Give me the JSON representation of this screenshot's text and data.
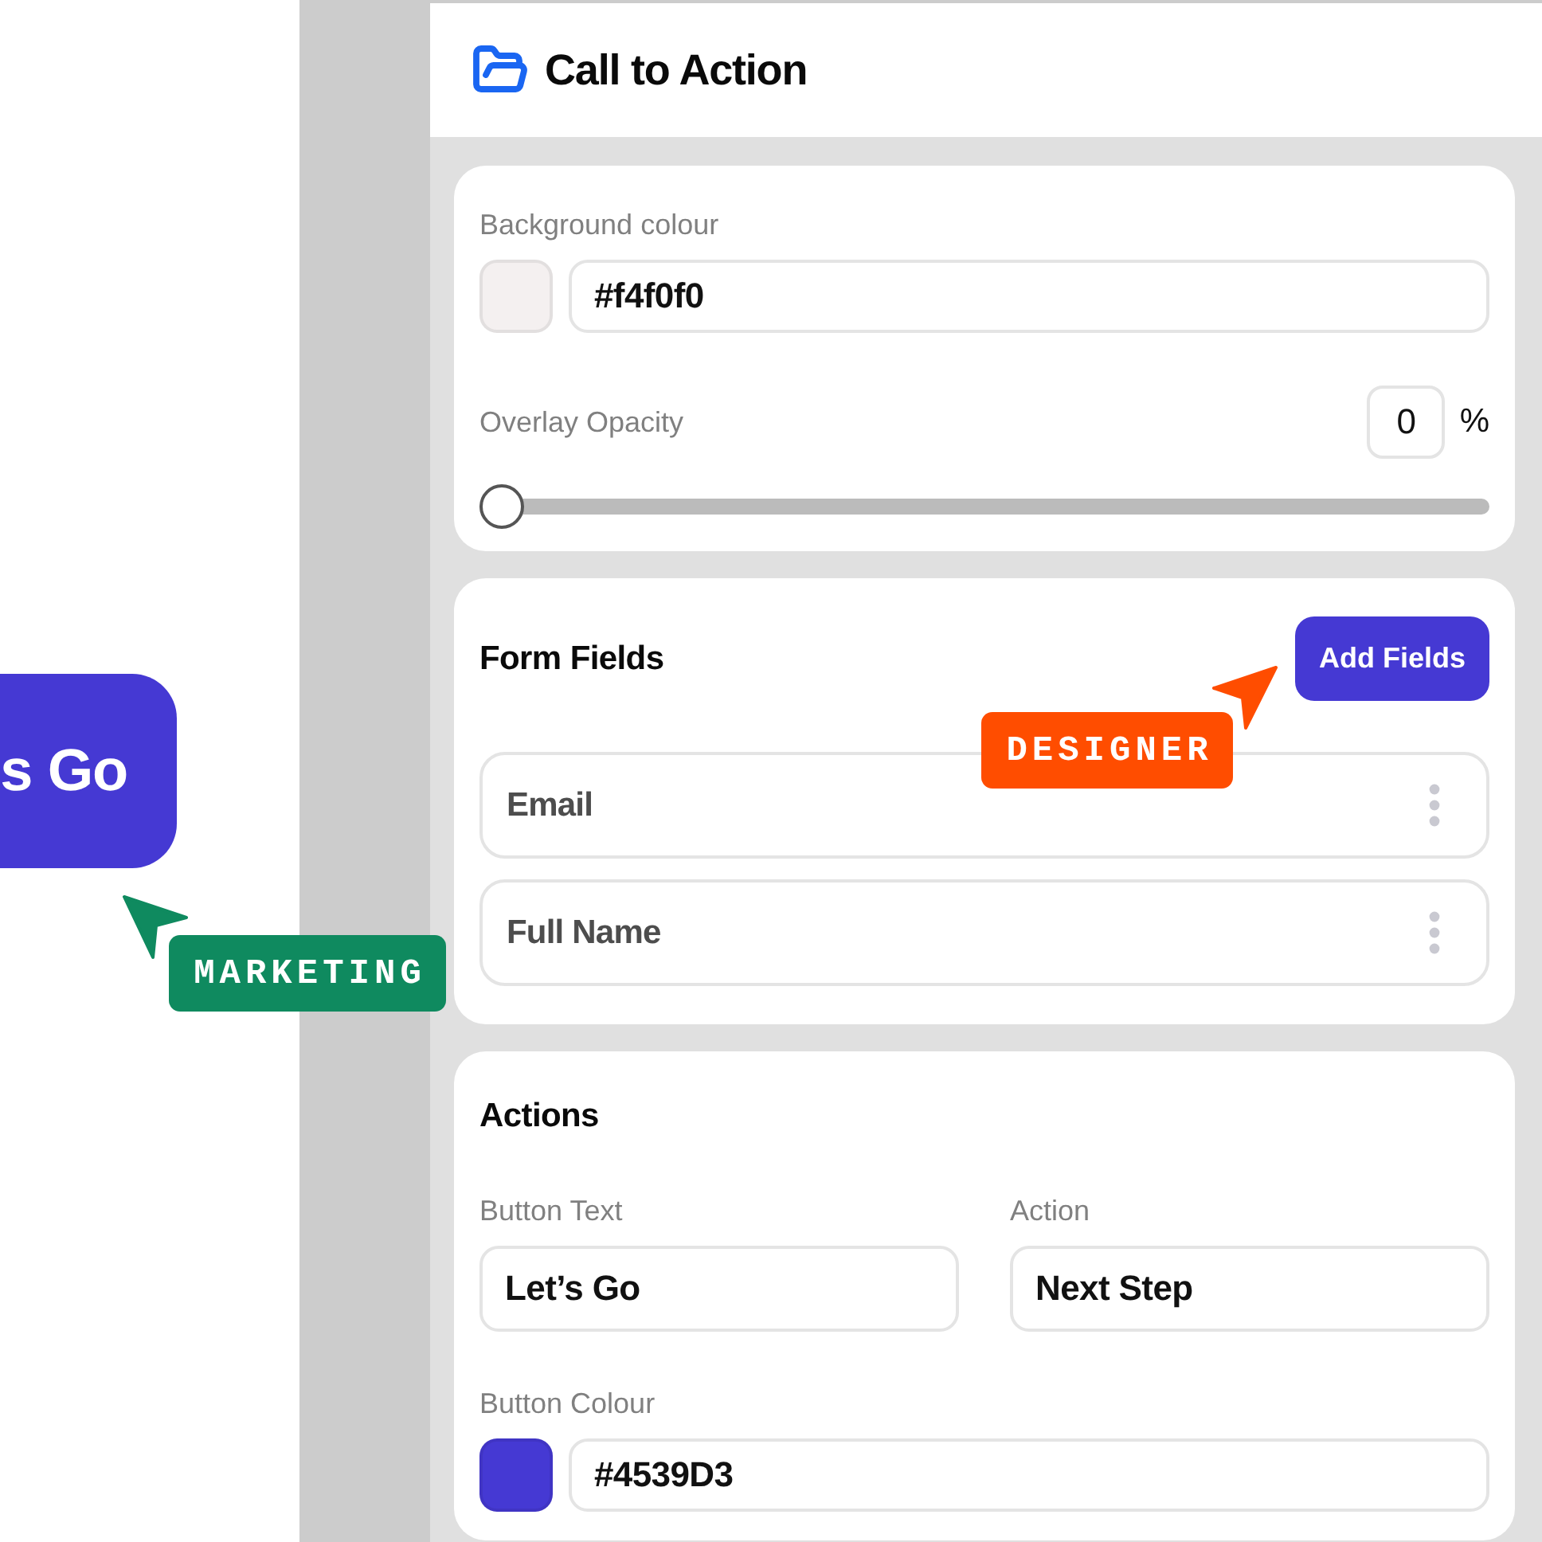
{
  "canvas": {
    "preview_button": {
      "label": "s Go"
    }
  },
  "cursors": [
    {
      "label": "MARKETING",
      "color": "#0f8a5f"
    },
    {
      "label": "DESIGNER",
      "color": "#ff4d00"
    }
  ],
  "panel": {
    "title": "Call to Action"
  },
  "appearance": {
    "background_colour": {
      "label": "Background colour",
      "value": "#f4f0f0",
      "color": "#f4f0f0"
    },
    "overlay_opacity": {
      "label": "Overlay Opacity",
      "value": "0",
      "unit": "%",
      "level": 0
    }
  },
  "form_fields": {
    "title": "Form Fields",
    "add_button": "Add Fields",
    "fields": [
      {
        "label": "Email"
      },
      {
        "label": "Full Name"
      }
    ]
  },
  "actions": {
    "title": "Actions",
    "button_text": {
      "label": "Button Text",
      "value": "Let’s Go"
    },
    "action": {
      "label": "Action",
      "value": "Next Step"
    },
    "button_colour": {
      "label": "Button Colour",
      "value": "#4539D3",
      "color": "#4539d3"
    }
  }
}
